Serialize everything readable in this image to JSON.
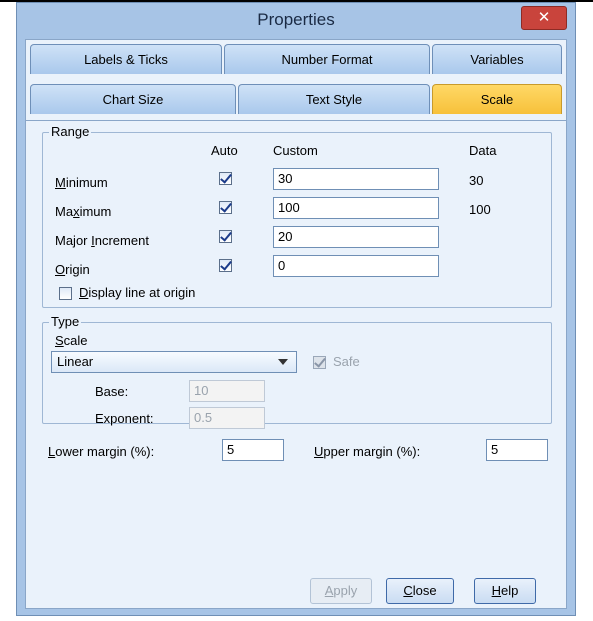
{
  "window": {
    "title": "Properties",
    "close_symbol": "✕"
  },
  "tabs_row1": [
    "Labels & Ticks",
    "Number Format",
    "Variables"
  ],
  "tabs_row2": [
    "Chart Size",
    "Text Style",
    "Scale"
  ],
  "active_tab": "Scale",
  "range": {
    "legend": "Range",
    "headers": {
      "auto": "Auto",
      "custom": "Custom",
      "data": "Data"
    },
    "rows": [
      {
        "label": "Minimum",
        "auto_checked": true,
        "custom": "30",
        "data": "30"
      },
      {
        "label": "Maximum",
        "auto_checked": true,
        "custom": "100",
        "data": "100"
      },
      {
        "label": "Major Increment",
        "auto_checked": true,
        "custom": "20",
        "data": ""
      },
      {
        "label": "Origin",
        "auto_checked": true,
        "custom": "0",
        "data": ""
      }
    ],
    "display_line_label": "Display line at origin",
    "display_line_checked": false
  },
  "type": {
    "legend": "Type",
    "scale_label": "Scale",
    "scale_value": "Linear",
    "safe_label": "Safe",
    "safe_checked": true,
    "base_label": "Base:",
    "base_value": "10",
    "exponent_label": "Exponent:",
    "exponent_value": "0.5"
  },
  "margins": {
    "lower_label": "Lower margin (%):",
    "lower_value": "5",
    "upper_label": "Upper margin (%):",
    "upper_value": "5"
  },
  "buttons": {
    "apply": "Apply",
    "close": "Close",
    "help": "Help"
  },
  "colors": {
    "active_tab": "#f7c13a",
    "frame": "#a7c4e6",
    "client": "#eaf2fb"
  }
}
